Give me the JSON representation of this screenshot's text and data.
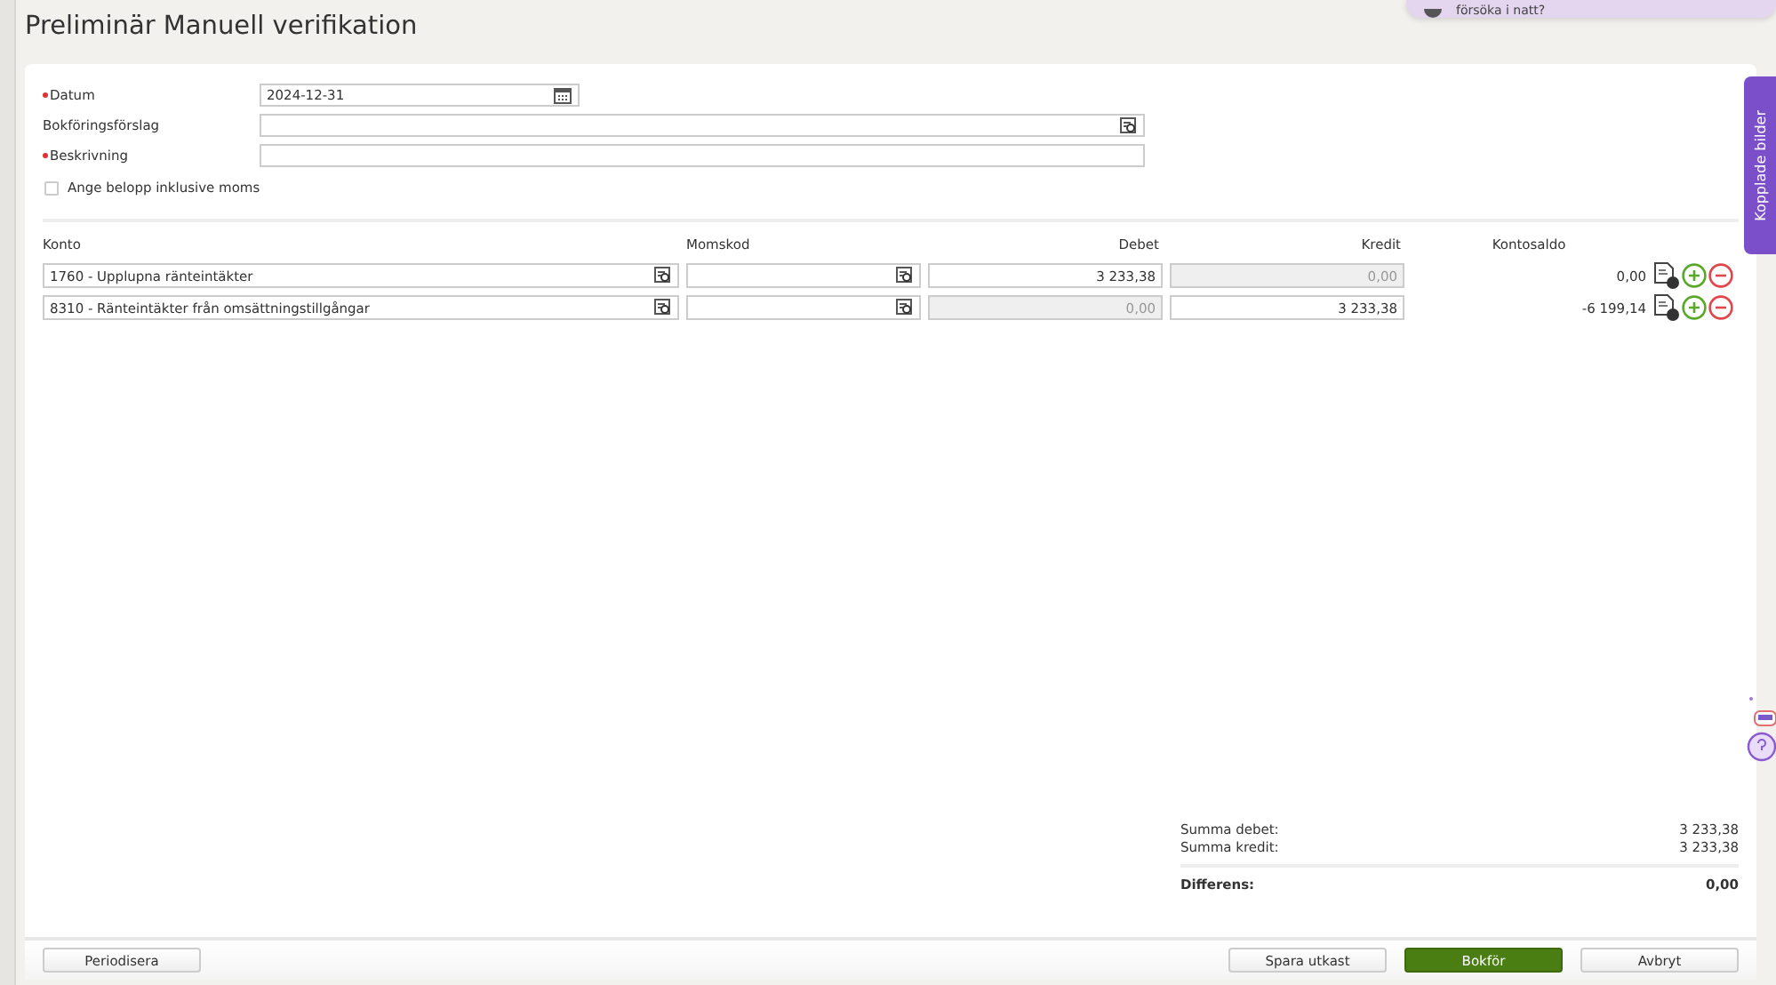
{
  "title": "Preliminär Manuell verifikation",
  "notification": {
    "text": "försöka i natt?"
  },
  "side_tab": {
    "label": "Kopplade bilder"
  },
  "form": {
    "fields": [
      {
        "label": "Datum",
        "required": true,
        "kind": "date",
        "value": "2024-12-31"
      },
      {
        "label": "Bokföringsförslag",
        "required": false,
        "kind": "lookup"
      },
      {
        "label": "Beskrivning",
        "required": true,
        "kind": "text"
      }
    ],
    "checkbox": {
      "label": "Ange belopp inklusive moms",
      "checked": false
    }
  },
  "table": {
    "columns": [
      "Konto",
      "Momskod",
      "Debet",
      "Kredit",
      "Kontosaldo"
    ],
    "rows": [
      {
        "account": "1760 - Upplupna ränteintäkter",
        "debit": {
          "value": "3 233,38",
          "disabled": false
        },
        "credit": {
          "value": "0,00",
          "disabled": true
        },
        "balance": "0,00"
      },
      {
        "account": "8310 - Ränteintäkter från omsättningstillgångar",
        "debit": {
          "value": "0,00",
          "disabled": true
        },
        "credit": {
          "value": "3 233,38",
          "disabled": false
        },
        "balance": "-6 199,14"
      }
    ]
  },
  "totals": [
    {
      "label": "Summa debet:",
      "value": "3 233,38",
      "bold": false
    },
    {
      "label": "Summa kredit:",
      "value": "3 233,38",
      "bold": false
    },
    {
      "label": "Differens:",
      "value": "0,00",
      "bold": true
    }
  ],
  "footer": {
    "left_buttons": [
      {
        "label": "Periodisera",
        "kind": "default"
      }
    ],
    "right_buttons": [
      {
        "label": "Spara utkast",
        "kind": "default"
      },
      {
        "label": "Bokför",
        "kind": "primary"
      },
      {
        "label": "Avbryt",
        "kind": "default"
      }
    ]
  }
}
